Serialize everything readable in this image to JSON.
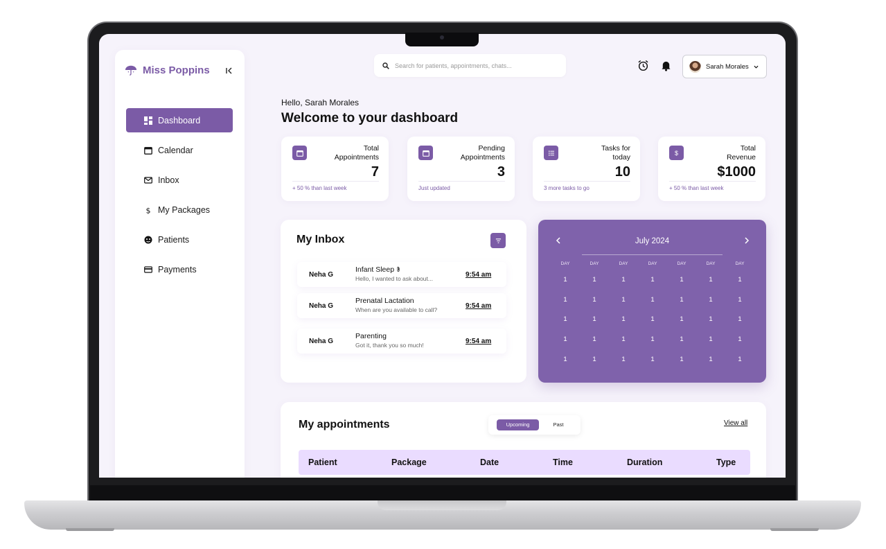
{
  "brand": {
    "name": "Miss Poppins",
    "accent": "#7b5ba6"
  },
  "sidebar": {
    "items": [
      {
        "label": "Dashboard",
        "icon": "dashboard-icon",
        "active": true
      },
      {
        "label": "Calendar",
        "icon": "calendar-icon"
      },
      {
        "label": "Inbox",
        "icon": "mail-icon"
      },
      {
        "label": "My Packages",
        "icon": "dollar-icon"
      },
      {
        "label": "Patients",
        "icon": "patients-icon"
      },
      {
        "label": "Payments",
        "icon": "card-icon"
      }
    ]
  },
  "search": {
    "placeholder": "Search for patients, appointments, chats..."
  },
  "user": {
    "name": "Sarah Morales"
  },
  "greeting": {
    "hello": "Hello, Sarah Morales",
    "title": "Welcome to your dashboard"
  },
  "stats": [
    {
      "label_1": "Total",
      "label_2": "Appointments",
      "value": "7",
      "note": "+ 50 % than last week",
      "icon": "calendar-icon"
    },
    {
      "label_1": "Pending",
      "label_2": "Appointments",
      "value": "3",
      "note": "Just updated",
      "icon": "calendar-icon"
    },
    {
      "label_1": "Tasks for",
      "label_2": "today",
      "value": "10",
      "note": "3 more tasks to go",
      "icon": "list-icon"
    },
    {
      "label_1": "Total",
      "label_2": "Revenue",
      "value": "$1000",
      "note": "+ 50 % than last week",
      "icon": "dollar-icon"
    }
  ],
  "inbox": {
    "title": "My Inbox",
    "messages": [
      {
        "from": "Neha G",
        "subject": "Infant Sleep",
        "preview": "Hello, I wanted to ask about...",
        "time": "9:54 am",
        "attachment": true
      },
      {
        "from": "Neha G",
        "subject": "Prenatal Lactation",
        "preview": "When are you available to call?",
        "time": "9:54 am"
      },
      {
        "from": "Neha G",
        "subject": "Parenting",
        "preview": "Got it, thank you so much!",
        "time": "9:54 am"
      }
    ]
  },
  "calendar": {
    "month": "July 2024",
    "day_header": "DAY",
    "cell_value": "1",
    "columns": 7,
    "rows": 5
  },
  "appointments": {
    "title": "My appointments",
    "tabs": [
      "Upcoming",
      "Past"
    ],
    "view_all": "View all",
    "columns": [
      "Patient",
      "Package",
      "Date",
      "Time",
      "Duration",
      "Type"
    ]
  }
}
